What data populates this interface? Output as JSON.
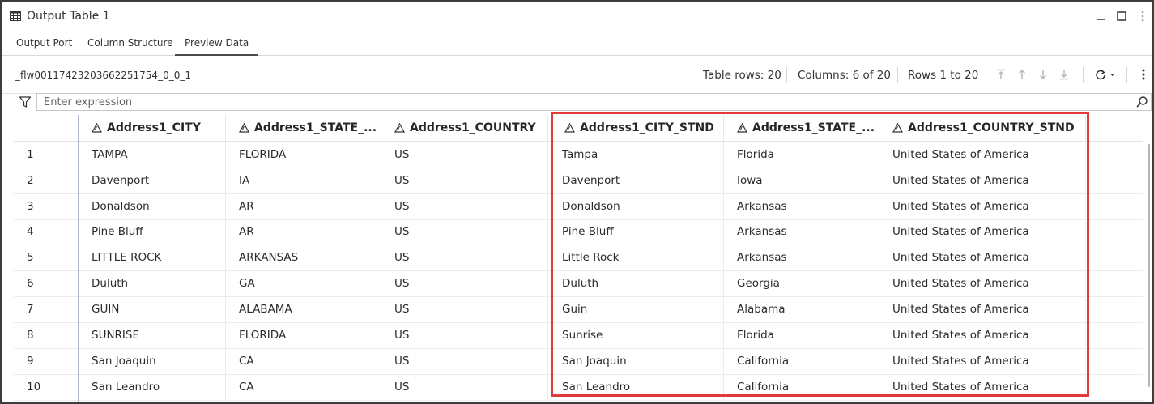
{
  "window": {
    "title": "Output Table 1",
    "table_icon": "table-icon",
    "minimize_icon": "minimize-icon",
    "maximize_icon": "maximize-icon",
    "more_icon": "vertical-ellipsis-icon"
  },
  "tabs": [
    {
      "label": "Output Port",
      "active": false
    },
    {
      "label": "Column Structure",
      "active": false
    },
    {
      "label": "Preview Data",
      "active": true
    }
  ],
  "toolbar": {
    "table_name": "_flw00117423203662251754_0_0_1",
    "table_rows": "Table rows: 20",
    "columns": "Columns: 6 of 20",
    "rows_range": "Rows 1 to 20",
    "nav_icons": [
      "first-page-icon",
      "previous-page-icon",
      "next-page-icon",
      "last-page-icon"
    ],
    "refresh_icon": "refresh-icon",
    "menu_icon": "vertical-ellipsis-icon"
  },
  "filter": {
    "icon": "filter-icon",
    "placeholder": "Enter expression",
    "value": "",
    "search_icon": "search-icon"
  },
  "grid": {
    "column_type_icon": "character-type-icon",
    "columns": [
      "Address1_CITY",
      "Address1_STATE_...",
      "Address1_COUNTRY",
      "Address1_CITY_STND",
      "Address1_STATE_...",
      "Address1_COUNTRY_STND"
    ],
    "rows": [
      {
        "n": "1",
        "cells": [
          "TAMPA",
          "FLORIDA",
          "US",
          "Tampa",
          "Florida",
          "United States of America"
        ]
      },
      {
        "n": "2",
        "cells": [
          "Davenport",
          "IA",
          "US",
          "Davenport",
          "Iowa",
          "United States of America"
        ]
      },
      {
        "n": "3",
        "cells": [
          "Donaldson",
          "AR",
          "US",
          "Donaldson",
          "Arkansas",
          "United States of America"
        ]
      },
      {
        "n": "4",
        "cells": [
          "Pine Bluff",
          "AR",
          "US",
          "Pine Bluff",
          "Arkansas",
          "United States of America"
        ]
      },
      {
        "n": "5",
        "cells": [
          "LITTLE ROCK",
          "ARKANSAS",
          "US",
          "Little Rock",
          "Arkansas",
          "United States of America"
        ]
      },
      {
        "n": "6",
        "cells": [
          "Duluth",
          "GA",
          "US",
          "Duluth",
          "Georgia",
          "United States of America"
        ]
      },
      {
        "n": "7",
        "cells": [
          "GUIN",
          "ALABAMA",
          "US",
          "Guin",
          "Alabama",
          "United States of America"
        ]
      },
      {
        "n": "8",
        "cells": [
          "SUNRISE",
          "FLORIDA",
          "US",
          "Sunrise",
          "Florida",
          "United States of America"
        ]
      },
      {
        "n": "9",
        "cells": [
          "San Joaquin",
          "CA",
          "US",
          "San Joaquin",
          "California",
          "United States of America"
        ]
      },
      {
        "n": "10",
        "cells": [
          "San Leandro",
          "CA",
          "US",
          "San Leandro",
          "California",
          "United States of America"
        ]
      }
    ]
  },
  "colors": {
    "highlight_border": "#e03a3a",
    "row_number_divider": "#6e7fb5"
  }
}
